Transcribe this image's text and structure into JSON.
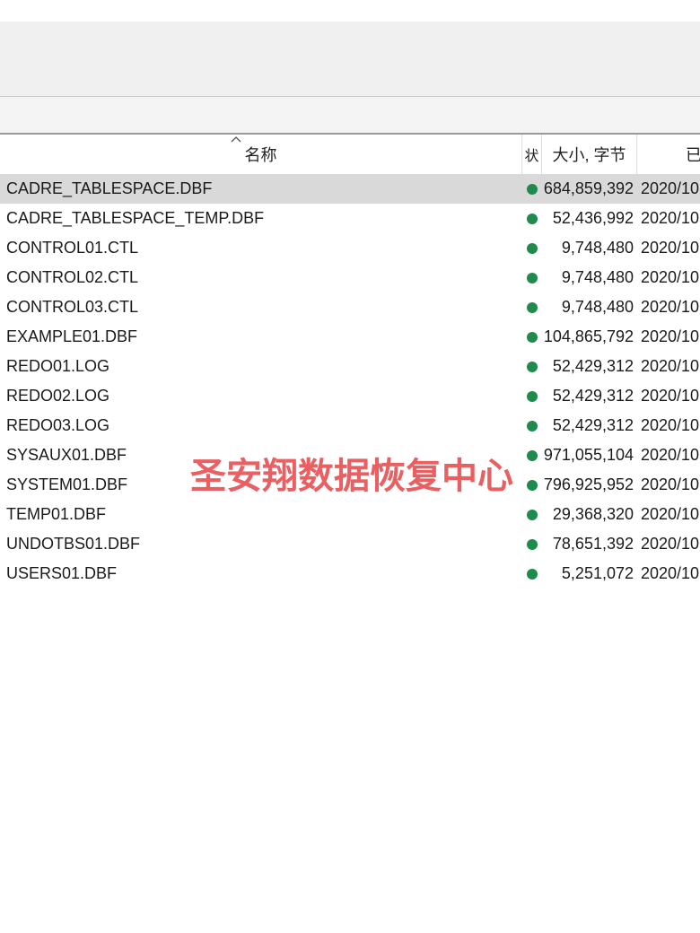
{
  "columns": {
    "name": "名称",
    "status": "状",
    "size": "大小, 字节",
    "date": "已"
  },
  "files": [
    {
      "name": "CADRE_TABLESPACE.DBF",
      "size": "684,859,392",
      "date": "2020/10",
      "selected": true
    },
    {
      "name": "CADRE_TABLESPACE_TEMP.DBF",
      "size": "52,436,992",
      "date": "2020/10"
    },
    {
      "name": "CONTROL01.CTL",
      "size": "9,748,480",
      "date": "2020/10"
    },
    {
      "name": "CONTROL02.CTL",
      "size": "9,748,480",
      "date": "2020/10"
    },
    {
      "name": "CONTROL03.CTL",
      "size": "9,748,480",
      "date": "2020/10"
    },
    {
      "name": "EXAMPLE01.DBF",
      "size": "104,865,792",
      "date": "2020/10"
    },
    {
      "name": "REDO01.LOG",
      "size": "52,429,312",
      "date": "2020/10"
    },
    {
      "name": "REDO02.LOG",
      "size": "52,429,312",
      "date": "2020/10"
    },
    {
      "name": "REDO03.LOG",
      "size": "52,429,312",
      "date": "2020/10"
    },
    {
      "name": "SYSAUX01.DBF",
      "size": "971,055,104",
      "date": "2020/10"
    },
    {
      "name": "SYSTEM01.DBF",
      "size": "796,925,952",
      "date": "2020/10"
    },
    {
      "name": "TEMP01.DBF",
      "size": "29,368,320",
      "date": "2020/10"
    },
    {
      "name": "UNDOTBS01.DBF",
      "size": "78,651,392",
      "date": "2020/10"
    },
    {
      "name": "USERS01.DBF",
      "size": "5,251,072",
      "date": "2020/10"
    }
  ],
  "status_color": "#1e8a4c",
  "watermark": "圣安翔数据恢复中心",
  "watermark_color": "#e8575a"
}
